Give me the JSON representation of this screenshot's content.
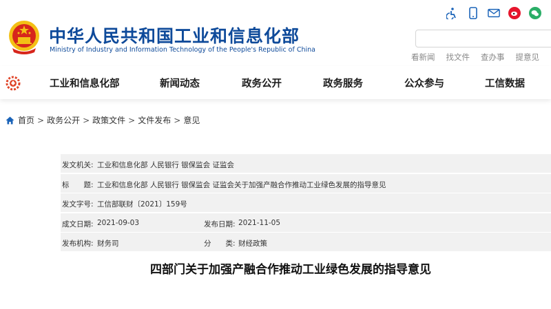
{
  "header": {
    "title_cn": "中华人民共和国工业和信息化部",
    "title_en": "Ministry of Industry and Information Technology of the People's Republic of China",
    "icons": [
      "accessibility-icon",
      "mobile-icon",
      "mail-icon",
      "weibo-icon",
      "wechat-icon"
    ],
    "search": {
      "value": "",
      "placeholder": ""
    },
    "quick_links": [
      "看新闻",
      "找文件",
      "查办事",
      "提意见"
    ]
  },
  "nav": {
    "items": [
      "工业和信息化部",
      "新闻动态",
      "政务公开",
      "政务服务",
      "公众参与",
      "工信数据"
    ]
  },
  "breadcrumb": {
    "items": [
      "首页",
      "政务公开",
      "政策文件",
      "文件发布",
      "意见"
    ]
  },
  "meta": {
    "issuer_label": "发文机关:",
    "issuer_value": "工业和信息化部 人民银行 银保监会 证监会",
    "title_label": "标　　题:",
    "title_value": "工业和信息化部 人民银行 银保监会 证监会关于加强产融合作推动工业绿色发展的指导意见",
    "docno_label": "发文字号:",
    "docno_value": "工信部联财〔2021〕159号",
    "created_label": "成文日期:",
    "created_value": "2021-09-03",
    "published_label": "发布日期:",
    "published_value": "2021-11-05",
    "org_label": "发布机构:",
    "org_value": "财务司",
    "category_label": "分　　类:",
    "category_value": "财经政策"
  },
  "document": {
    "title": "四部门关于加强产融合作推动工业绿色发展的指导意见"
  },
  "colors": {
    "brand_blue": "#0e4a9a",
    "emblem_red": "#d7261c",
    "gold": "#f3c015",
    "weibo": "#e6162d",
    "wechat": "#2aae67"
  }
}
